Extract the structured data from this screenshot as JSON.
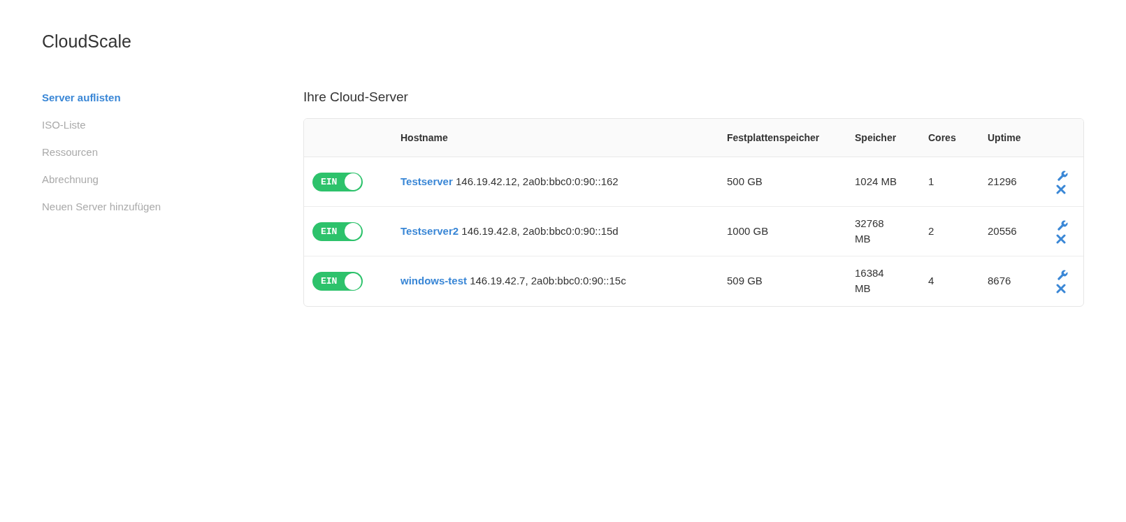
{
  "brand": "CloudScale",
  "sidebar": {
    "items": [
      {
        "label": "Server auflisten",
        "selected": true
      },
      {
        "label": "ISO-Liste",
        "selected": false
      },
      {
        "label": "Ressourcen",
        "selected": false
      },
      {
        "label": "Abrechnung",
        "selected": false
      },
      {
        "label": "Neuen Server hinzufügen",
        "selected": false
      }
    ]
  },
  "heading": "Ihre Cloud-Server",
  "table": {
    "columns": [
      "Hostname",
      "Festplattenspeicher",
      "Speicher",
      "Cores",
      "Uptime"
    ],
    "rows": [
      {
        "on": true,
        "toggle_label": "EIN",
        "hostname": "Testserver",
        "addresses": "146.19.42.12, 2a0b:bbc0:0:90::162",
        "disk": "500 GB",
        "memory": "1024 MB",
        "cores": "1",
        "uptime": "21296"
      },
      {
        "on": true,
        "toggle_label": "EIN",
        "hostname": "Testserver2",
        "addresses": "146.19.42.8, 2a0b:bbc0:0:90::15d",
        "disk": "1000 GB",
        "memory": "32768 MB",
        "cores": "2",
        "uptime": "20556"
      },
      {
        "on": true,
        "toggle_label": "EIN",
        "hostname": "windows-test",
        "addresses": "146.19.42.7, 2a0b:bbc0:0:90::15c",
        "disk": "509 GB",
        "memory": "16384 MB",
        "cores": "4",
        "uptime": "8676"
      }
    ]
  }
}
